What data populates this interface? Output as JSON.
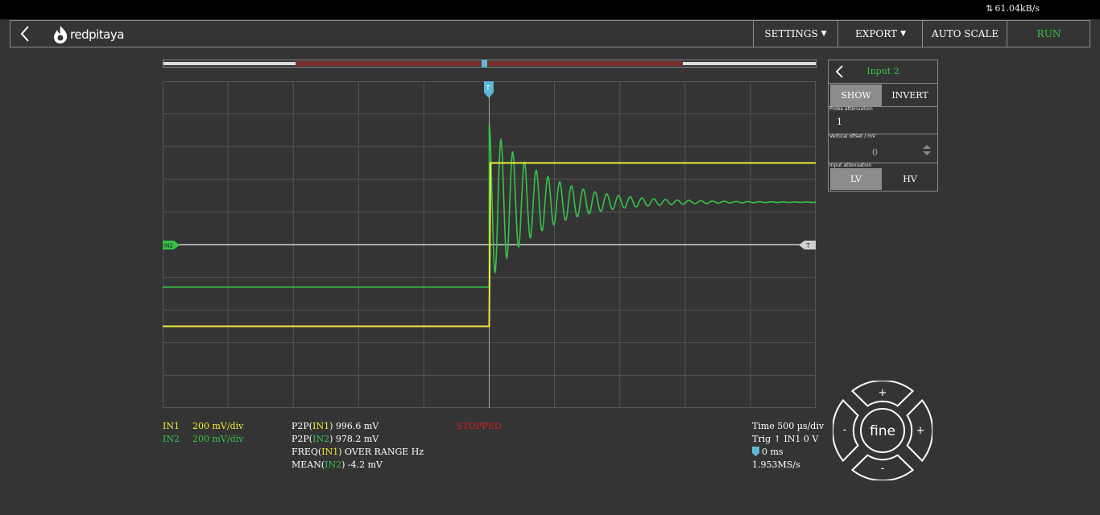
{
  "status_bar": {
    "rate_text": "61.04kB/s"
  },
  "header": {
    "logo_text": "redpitaya",
    "settings_label": "SETTINGS",
    "export_label": "EXPORT",
    "autoscale_label": "AUTO SCALE",
    "run_label": "RUN"
  },
  "trigger_marker": "T",
  "channel_marker": "IN2",
  "level_marker": "T",
  "input_panel": {
    "title": "Input 2",
    "show_label": "SHOW",
    "invert_label": "INVERT",
    "probe_label": "Probe attenuation",
    "probe_value": "1",
    "offset_label": "Vertical offset / mV",
    "offset_value": "0",
    "input_att_label": "Input attenuation",
    "lv_label": "LV",
    "hv_label": "HV"
  },
  "channels": [
    {
      "name": "IN1",
      "scale": "200 mV/div",
      "color": "#f1eb3c"
    },
    {
      "name": "IN2",
      "scale": "200 mV/div",
      "color": "#37c24a"
    }
  ],
  "measurements": {
    "m1_prefix": "P2P(",
    "m1_ch": "IN1",
    "m1_value": ") 996.6 mV",
    "m2_prefix": "P2P(",
    "m2_ch": "IN2",
    "m2_value": ") 978.2 mV",
    "m3_prefix": "FREQ(",
    "m3_ch": "IN1",
    "m3_value": ") OVER RANGE Hz",
    "m4_prefix": "MEAN(",
    "m4_ch": "IN2",
    "m4_value": ") -4.2 mV"
  },
  "status": "STOPPED",
  "timebase": {
    "time": "Time 500 µs/div",
    "trig": "Trig ↑ IN1 0 V",
    "delay": "0 ms",
    "sample_rate": "1.953MS/s"
  },
  "pad_center_label": "fine",
  "pad_plus": "+",
  "pad_minus": "-",
  "colors": {
    "background": "#343434",
    "ch1": "#f1eb3c",
    "ch2": "#37c24a",
    "trigger_marker": "#5fb6d6",
    "overview_window": "#7a2f2f",
    "stopped": "#d42222"
  },
  "chart_data": {
    "type": "line",
    "xlabel": "",
    "ylabel": "",
    "grid": true,
    "divisions": {
      "x": 10,
      "y": 10
    },
    "x_units": "div",
    "y_units": "div",
    "xlim": [
      -5,
      5
    ],
    "ylim": [
      -5,
      5
    ],
    "series": [
      {
        "name": "IN1",
        "color": "#f1eb3c",
        "points": [
          [
            -5,
            -2.5
          ],
          [
            0,
            -2.5
          ],
          [
            0.02,
            2.5
          ],
          [
            5,
            2.5
          ]
        ]
      },
      {
        "name": "IN2",
        "color": "#37c24a",
        "initial_level": -1.3,
        "final_level": 1.3,
        "step_time": 0,
        "ring_period": 0.18,
        "ring_amplitude": 2.4,
        "ring_decay": 0.8
      }
    ],
    "reference_level": 0
  }
}
